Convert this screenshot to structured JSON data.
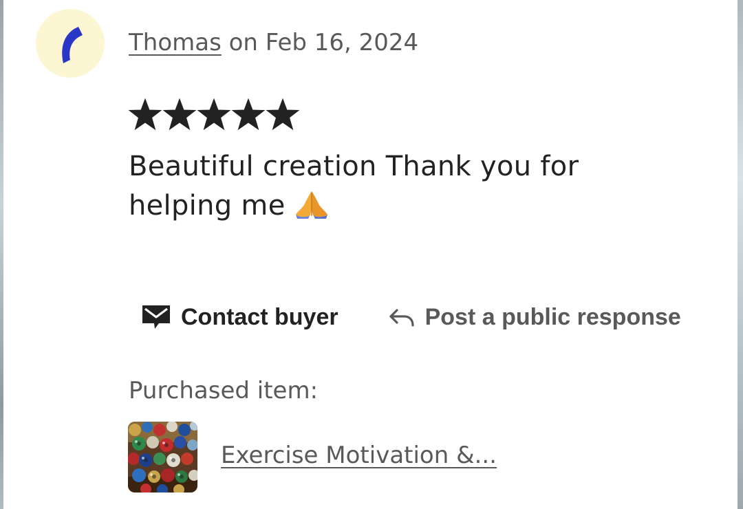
{
  "review": {
    "reviewer_name": "Thomas",
    "date_prefix": " on ",
    "date": "Feb 16, 2024",
    "rating": 5,
    "max_rating": 5,
    "text": "Beautiful creation Thank you for helping me",
    "emoji_icon": "folded-hands-icon"
  },
  "avatar": {
    "icon": "blue-arc-avatar-icon",
    "background_color": "#fdf6d3",
    "mark_color": "#2a36c8"
  },
  "actions": {
    "contact_label": "Contact buyer",
    "contact_icon": "mail-icon",
    "respond_label": "Post a public response",
    "respond_icon": "reply-arrow-icon"
  },
  "purchase": {
    "label": "Purchased item:",
    "item_title": "Exercise Motivation &...",
    "thumbnail_icon": "beads-thumbnail-image"
  },
  "colors": {
    "primary_text": "#222222",
    "secondary_text": "#595959",
    "star": "#222222"
  }
}
